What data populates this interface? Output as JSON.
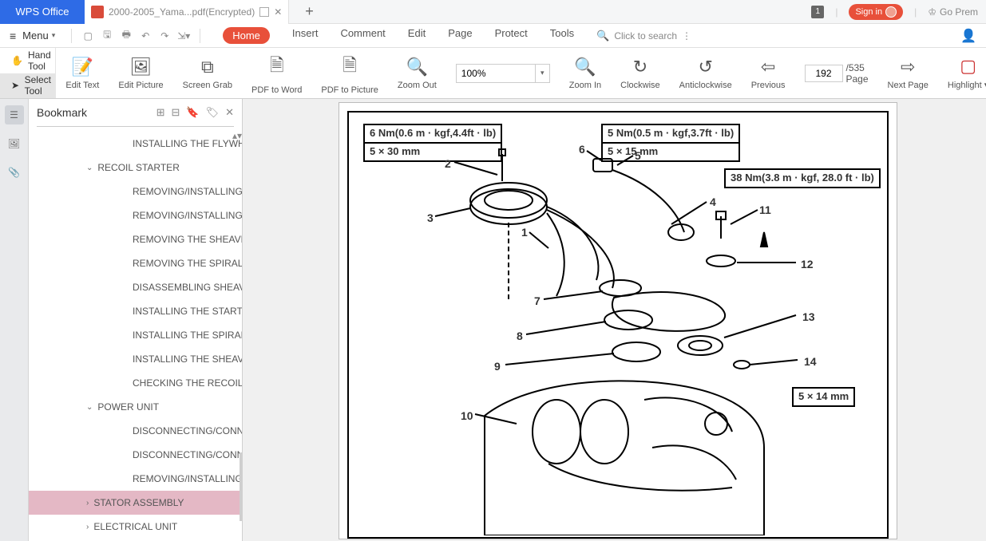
{
  "brand": "WPS Office",
  "doc_tab": {
    "name": "2000-2005_Yama...pdf(Encrypted)"
  },
  "title_right": {
    "badge": "1",
    "signin": "Sign in",
    "premium": "Go Prem"
  },
  "menubar": {
    "menu": "Menu",
    "tabs": {
      "home": "Home",
      "insert": "Insert",
      "comment": "Comment",
      "edit": "Edit",
      "page": "Page",
      "protect": "Protect",
      "tools": "Tools"
    },
    "search": "Click to search"
  },
  "tools_side": {
    "hand": "Hand Tool",
    "select": "Select Tool"
  },
  "ribbon": {
    "edit_text": "Edit Text",
    "edit_picture": "Edit Picture",
    "screen_grab": "Screen Grab",
    "pdf_to_word": "PDF to Word",
    "pdf_to_picture": "PDF to Picture",
    "zoom_out": "Zoom Out",
    "zoom_value": "100%",
    "zoom_in": "Zoom In",
    "clockwise": "Clockwise",
    "anticlockwise": "Anticlockwise",
    "previous": "Previous",
    "page_current": "192",
    "page_total": "/535 Page",
    "next_page": "Next Page",
    "highlight": "Highlight"
  },
  "bookmark": {
    "title": "Bookmark"
  },
  "tree": {
    "installing_flywheel": "INSTALLING THE FLYWHE...",
    "recoil_starter": "RECOIL STARTER",
    "removing_installing_1": "REMOVING/INSTALLING T...",
    "removing_installing_2": "REMOVING/INSTALLING T...",
    "removing_sheave": "REMOVING THE SHEAVE D...",
    "removing_spiral": "REMOVING THE SPIRAL SP...",
    "disassembling_sheave": "DISASSEMBLING SHEAVE ...",
    "installing_starter": "INSTALLING THE STARTER...",
    "installing_spiral": "INSTALLING THE SPIRAL S...",
    "installing_sheave": "INSTALLING THE SHEAVE ...",
    "checking_recoil": "CHECKING THE RECOIL ST...",
    "power_unit": "POWER UNIT",
    "disconnecting_1": "DISCONNECTING/CONNE...",
    "disconnecting_2": "DISCONNECTING/CONNE...",
    "removing_installing_3": "REMOVING/INSTALLING T...",
    "stator_assembly": "STATOR ASSEMBLY",
    "electrical_unit": "ELECTRICAL UNIT"
  },
  "diagram": {
    "box1_l1": "6 Nm(0.6 m · kgf,4.4ft · lb)",
    "box1_l2": "5 × 30 mm",
    "box2_l1": "5 Nm(0.5 m · kgf,3.7ft · lb)",
    "box2_l2": "5 × 15 mm",
    "box3": "38 Nm(3.8 m · kgf, 28.0 ft · lb)",
    "box4": "5 × 14 mm",
    "n1": "1",
    "n2": "2",
    "n3": "3",
    "n4": "4",
    "n5": "5",
    "n6": "6",
    "n7": "7",
    "n8": "8",
    "n9": "9",
    "n10": "10",
    "n11": "11",
    "n12": "12",
    "n13": "13",
    "n14": "14"
  }
}
